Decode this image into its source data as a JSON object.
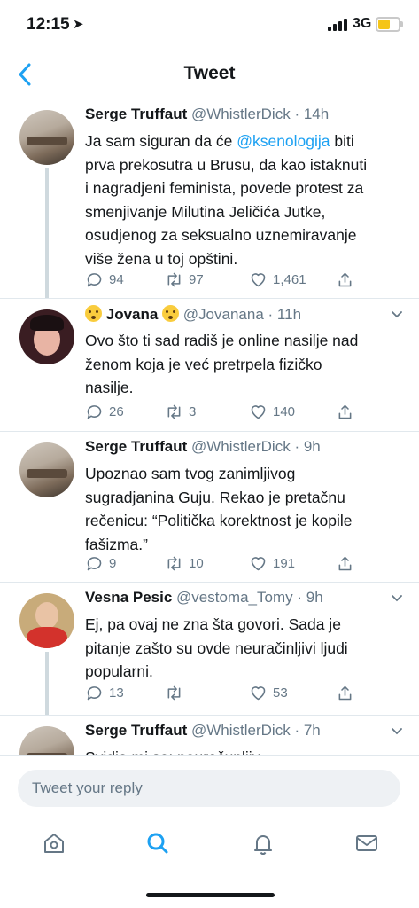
{
  "status_bar": {
    "time": "12:15",
    "network": "3G"
  },
  "header": {
    "title": "Tweet"
  },
  "tweets": [
    {
      "name": "Serge Truffaut",
      "handle": "@WhistlerDick",
      "time": "· 14h",
      "text_parts": [
        "Ja sam siguran da će ",
        "@ksenologija",
        " biti\nprva prekosutra u Brusu, da kao istaknuti\ni nagradjeni feminista, povede protest za\nsmenjivanje Milutina Jeličića Jutke,\nosudjenog za seksualno uznemiravanje\nviše žena u toj opštini."
      ],
      "replies": "94",
      "retweets": "97",
      "likes": "1,461"
    },
    {
      "name": "Jovana",
      "handle": "@Jovanana",
      "time": "· 11h",
      "text": "Ovo što ti sad radiš je online nasilje nad\nženom koja je već pretrpela fizičko\nnasilje.",
      "replies": "26",
      "retweets": "3",
      "likes": "140"
    },
    {
      "name": "Serge Truffaut",
      "handle": "@WhistlerDick",
      "time": "· 9h",
      "text": "Upoznao sam tvog zanimljivog\nsugradjanina Guju. Rekao je pretačnu\nrečenicu: “Politička korektnost je kopile\nfašizma.”",
      "replies": "9",
      "retweets": "10",
      "likes": "191"
    },
    {
      "name": "Vesna Pesic",
      "handle": "@vestoma_Tomy",
      "time": "· 9h",
      "text": "Ej, pa ovaj ne zna šta govori. Sada je\npitanje zašto su ovde neuračinljivi ljudi\npopularni.",
      "replies": "13",
      "retweets": "",
      "likes": "53"
    },
    {
      "name": "Serge Truffaut",
      "handle": "@WhistlerDick",
      "time": "· 7h",
      "text": "Svidja mi se: neuračunljiv."
    }
  ],
  "reply": {
    "placeholder": "Tweet your reply"
  },
  "tabs": [
    "home-icon",
    "search-icon",
    "notifications-icon",
    "messages-icon"
  ],
  "colors": {
    "accent": "#1da1f2",
    "muted": "#657786",
    "divider": "#e1e8ed"
  }
}
